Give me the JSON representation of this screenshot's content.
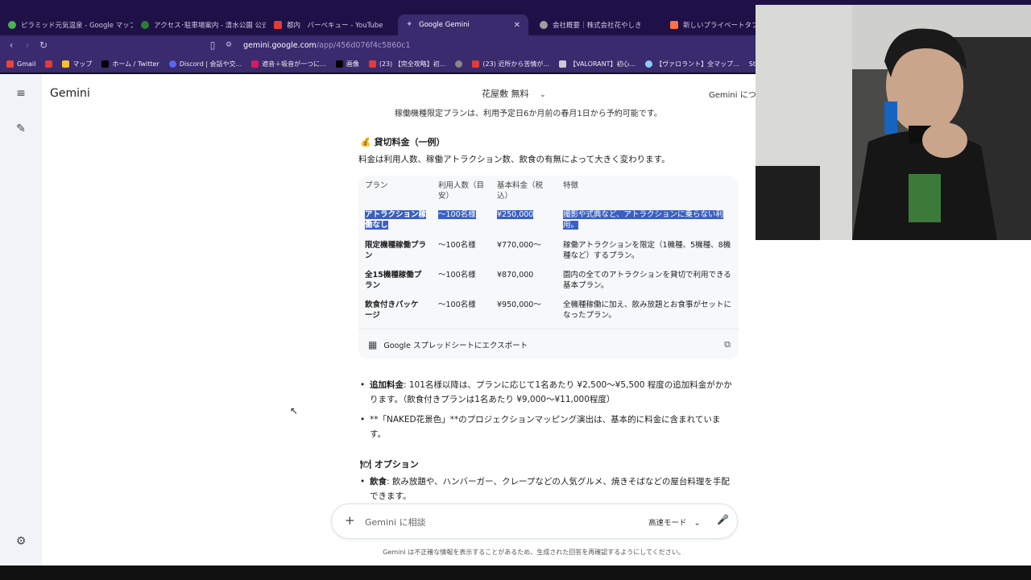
{
  "browser": {
    "tabs": [
      {
        "title": "ピラミッド元気温泉 - Google マップ",
        "color": "#4caf50"
      },
      {
        "title": "アクセス･駐車場案内 - 清水公園 公式",
        "color": "#2e7d32"
      },
      {
        "title": "都内　バーベキュー - YouTube",
        "color": "#e53935"
      },
      {
        "title": "Google Gemini",
        "color": "#8ab4f8"
      },
      {
        "title": "会社概要｜株式会社花やしき",
        "color": "#9e9e9e"
      },
      {
        "title": "新しいプライベートタブ",
        "color": "#ff7043"
      }
    ],
    "active_tab_index": 3,
    "url_host": "gemini.google.com",
    "url_path": "/app/456d076f4c5860c1",
    "bookmarks": [
      "Gmail",
      "マップ",
      "ホーム / Twitter",
      "Discord | 会話や交...",
      "遮音＋吸音が一つに...",
      "画像",
      "(23) 【完全攻略】初...",
      "(23) 近所から苦情が...",
      "【VALORANT】初心...",
      "【ヴァロラント】全マップ...",
      "SteamDB"
    ]
  },
  "app": {
    "brand": "Gemini",
    "chat_title": "花屋敷 無料",
    "top_right": "Gemini につい",
    "cut_line": "稼働機種限定プランは、利用予定日6か月前の春月1日から予約可能です。",
    "section1_heading": "💰 貸切料金（一例）",
    "section1_para": "料金は利用人数、稼働アトラクション数、飲食の有無によって大きく変わります。",
    "table": {
      "headers": [
        "プラン",
        "利用人数（目安）",
        "基本料金（税込）",
        "特徴"
      ],
      "rows": [
        [
          "アトラクション稼働なし",
          "〜100名様",
          "¥250,000",
          "撮影や式典など、アトラクションに乗らない利用。"
        ],
        [
          "限定機種稼働プラン",
          "〜100名様",
          "¥770,000〜",
          "稼働アトラクションを限定（1機種、5機種、8機種など）するプラン。"
        ],
        [
          "全15機種稼働プラン",
          "〜100名様",
          "¥870,000",
          "園内の全てのアトラクションを貸切で利用できる基本プラン。"
        ],
        [
          "飲食付きパッケージ",
          "〜100名様",
          "¥950,000〜",
          "全機種稼働に加え、飲み放題とお食事がセットになったプラン。"
        ]
      ],
      "highlighted_row": 0,
      "export_label": "Google スプレッドシートにエクスポート"
    },
    "bullets": [
      {
        "bold": "追加料金",
        "text": ": 101名様以降は、プランに応じて1名あたり ¥2,500〜¥5,500 程度の追加料金がかかります。（飲食付きプランは1名あたり ¥9,000〜¥11,000程度）"
      },
      {
        "bold": "",
        "text": "**「NAKED花景色」**のプロジェクションマッピング演出は、基本的に料金に含まれています。"
      }
    ],
    "section2_heading": "🍽 オプション",
    "option_bullet": {
      "bold": "飲食",
      "text": ": 飲み放題や、ハンバーガー、クレープなどの人気グルメ、焼きそばなどの屋台料理を手配できます。"
    },
    "input_placeholder": "Gemini に相談",
    "mode_label": "高速モード",
    "disclaimer": "Gemini は不正確な情報を表示することがあるため、生成された回答を再確認するようにしてください。"
  }
}
